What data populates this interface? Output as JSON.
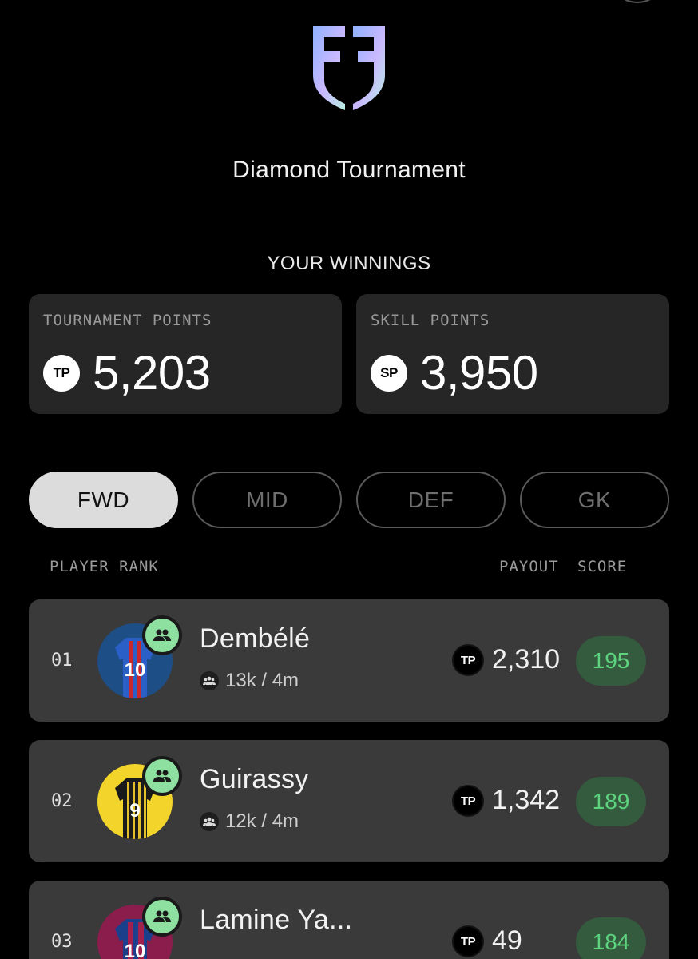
{
  "header": {
    "logo": "ff-shield-logo",
    "title": "Diamond Tournament"
  },
  "winnings": {
    "label": "YOUR WINNINGS",
    "tournament": {
      "label": "TOURNAMENT POINTS",
      "badge": "TP",
      "value": "5,203"
    },
    "skill": {
      "label": "SKILL POINTS",
      "badge": "SP",
      "value": "3,950"
    }
  },
  "tabs": [
    {
      "label": "FWD",
      "active": true
    },
    {
      "label": "MID",
      "active": false
    },
    {
      "label": "DEF",
      "active": false
    },
    {
      "label": "GK",
      "active": false
    }
  ],
  "columns": {
    "rank": "PLAYER RANK",
    "payout": "PAYOUT",
    "score": "SCORE"
  },
  "players": [
    {
      "rank": "01",
      "name": "Dembélé",
      "ownership": "13k / 4m",
      "payout_badge": "TP",
      "payout": "2,310",
      "score": "195",
      "jersey": "10"
    },
    {
      "rank": "02",
      "name": "Guirassy",
      "ownership": "12k / 4m",
      "payout_badge": "TP",
      "payout": "1,342",
      "score": "189",
      "jersey": "9"
    },
    {
      "rank": "03",
      "name": "Lamine Ya...",
      "ownership": "",
      "payout_badge": "TP",
      "payout": "49",
      "score": "184",
      "jersey": "10"
    }
  ],
  "colors": {
    "background": "#000000",
    "card": "#262626",
    "row": "#3a3a3a",
    "score_bg": "#345b3e",
    "score_text": "#5dd37e",
    "group_badge": "#8de0a0"
  }
}
